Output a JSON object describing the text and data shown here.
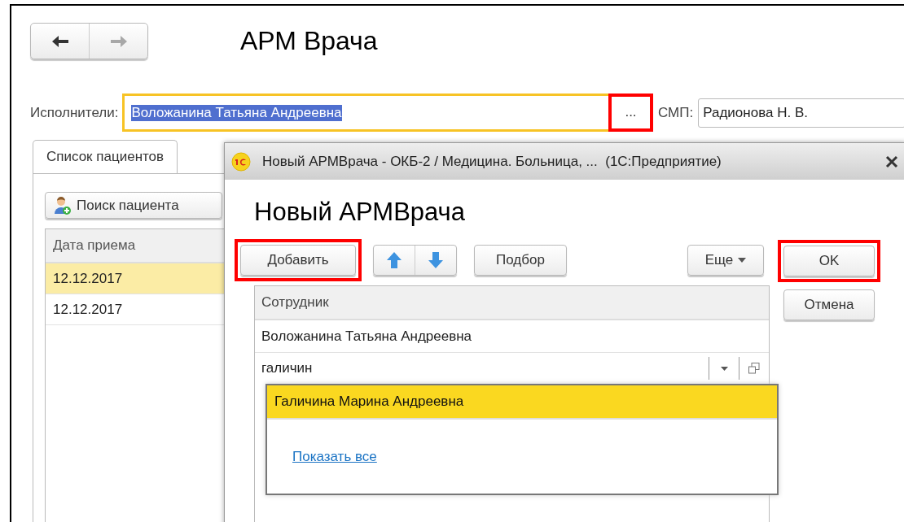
{
  "nav": [
    {
      "kind": "back",
      "disabled": false
    },
    {
      "kind": "forward",
      "disabled": true
    }
  ],
  "title": "АРМ Врача",
  "performers": {
    "label": "Исполнители:",
    "value": "Воложанина Татьяна Андреевна",
    "text_selected": true,
    "button": "...",
    "button_marked": true
  },
  "smp": {
    "label": "СМП:",
    "value": "Радионова Н. В."
  },
  "tabs": [
    {
      "label": "Список пациентов",
      "selected": true
    }
  ],
  "patients": {
    "search_button": "Поиск пациента",
    "columns": [
      "Дата приема"
    ],
    "rows": [
      {
        "cells": [
          "12.12.2017"
        ],
        "selected": true
      },
      {
        "cells": [
          "12.12.2017"
        ],
        "selected": false
      }
    ]
  },
  "dialog": {
    "title": "Новый АРМВрача - ОКБ-2 / Медицина. Больница, ...  (1С:Предприятие)",
    "heading": "Новый АРМВрача",
    "toolbar": [
      {
        "kind": "button",
        "label": "Добавить",
        "marked": true
      },
      {
        "kind": "arrows"
      },
      {
        "kind": "button",
        "label": "Подбор",
        "marked": false
      },
      {
        "kind": "menu",
        "label": "Еще",
        "marked": false
      }
    ],
    "side_buttons": [
      {
        "label": "OK",
        "marked": true
      },
      {
        "label": "Отмена",
        "marked": false
      }
    ],
    "table": {
      "columns": [
        "Сотрудник"
      ],
      "rows": [
        {
          "kind": "text",
          "value": "Воложанина Татьяна Андреевна"
        },
        {
          "kind": "edit",
          "value": "галичин"
        }
      ]
    },
    "dropdown": {
      "items": [
        {
          "label": "Галичина Марина Андреевна",
          "selected": true
        }
      ],
      "link": "Показать все"
    }
  }
}
